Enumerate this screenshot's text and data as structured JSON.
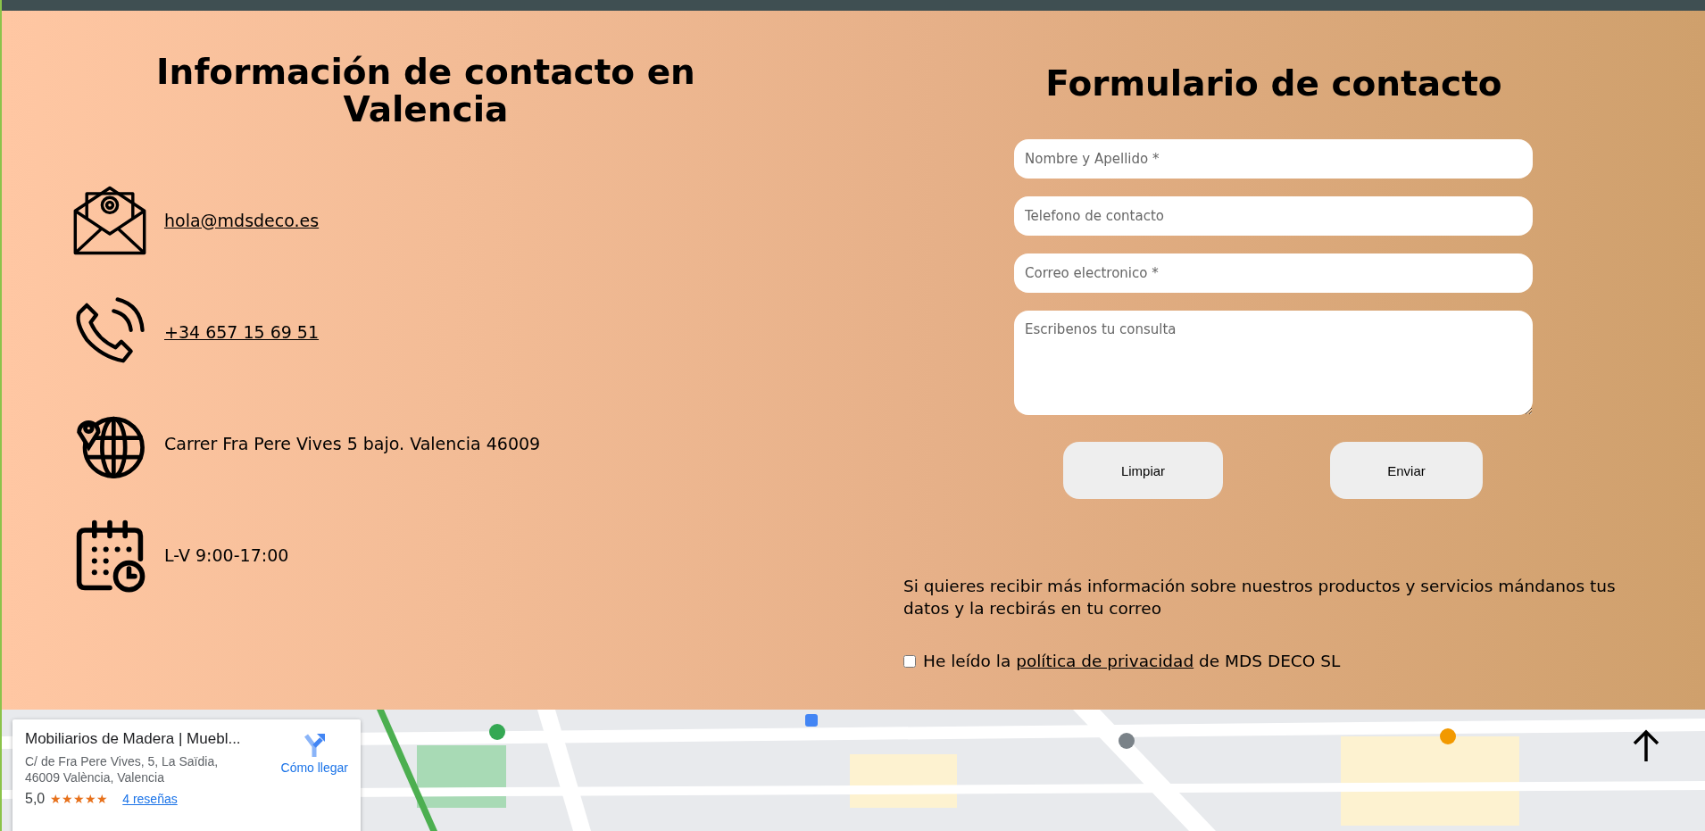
{
  "contact_info": {
    "title": "Información de contacto en Valencia",
    "items": [
      {
        "kind": "email",
        "text": "hola@mdsdeco.es",
        "link": true
      },
      {
        "kind": "phone",
        "text": "+34 657 15 69 51",
        "link": true
      },
      {
        "kind": "address",
        "text": "Carrer Fra Pere Vives 5 bajo. Valencia 46009",
        "link": false
      },
      {
        "kind": "hours",
        "text": "L-V 9:00-17:00",
        "link": false
      }
    ]
  },
  "contact_form": {
    "title": "Formulario de contacto",
    "fields": [
      {
        "kind": "input",
        "placeholder": "Nombre y Apellido *"
      },
      {
        "kind": "input",
        "placeholder": "Telefono de contacto"
      },
      {
        "kind": "input",
        "placeholder": "Correo electronico *"
      },
      {
        "kind": "textarea",
        "placeholder": "Escribenos tu consulta"
      }
    ],
    "buttons": [
      "Limpiar",
      "Enviar"
    ],
    "note": "Si quieres recibir más información sobre nuestros productos y servicios mándanos tus datos y la recbirás en tu correo",
    "privacy": {
      "checked": false,
      "before": "He leído la",
      "link": "política de privacidad",
      "after": "de MDS DECO SL"
    }
  },
  "map": {
    "place_card": {
      "name": "Mobiliarios de Madera | Muebl...",
      "address_lines": [
        "C/ de Fra Pere Vives, 5, La Saïdia,",
        "46009 València, Valencia"
      ],
      "rating": "5,0",
      "stars": 5,
      "reviews": "4 reseñas",
      "directions": "Cómo llegar"
    }
  }
}
